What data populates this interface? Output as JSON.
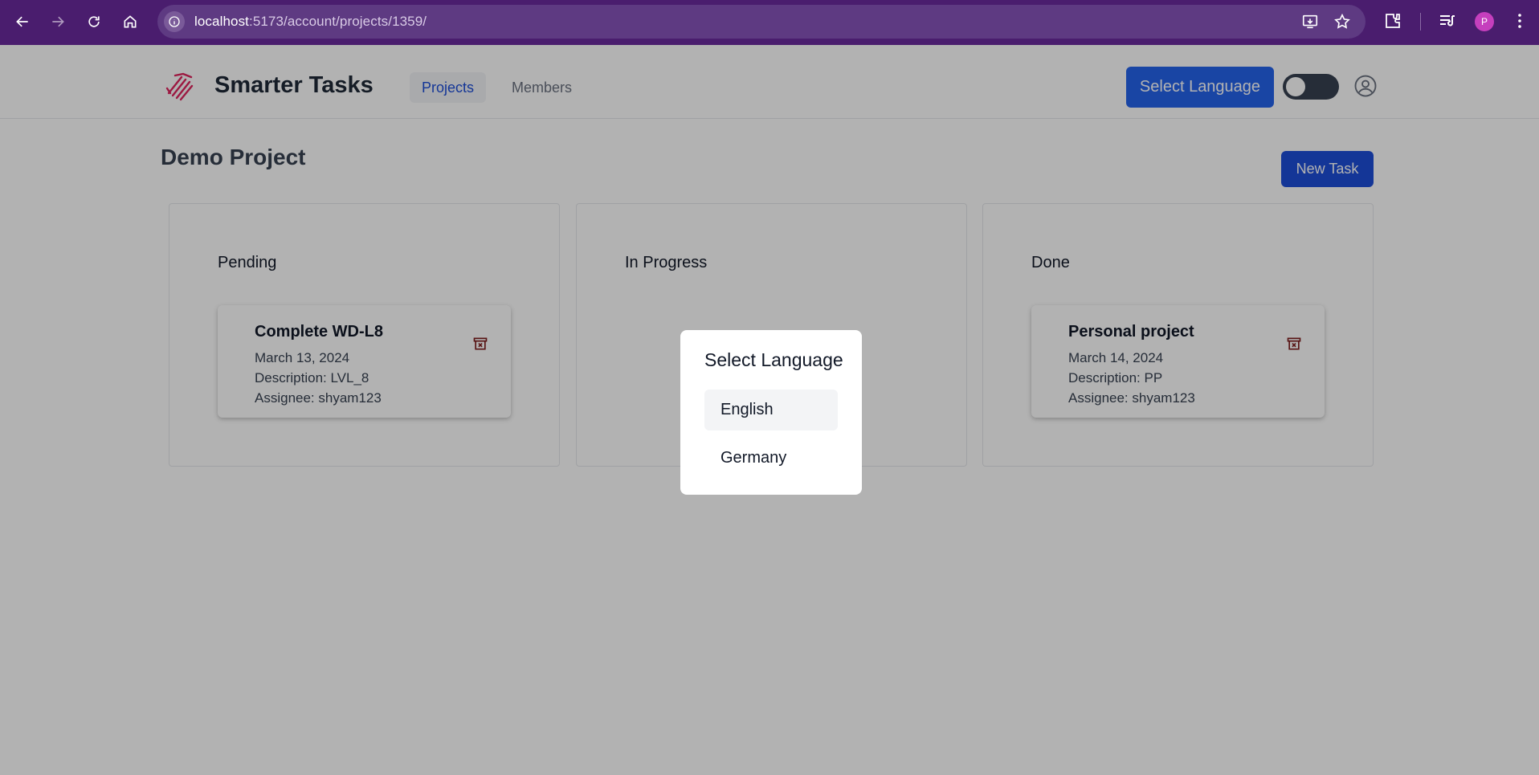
{
  "browser": {
    "url_host": "localhost",
    "url_path": ":5173/account/projects/1359/",
    "profile_initial": "P",
    "icons": [
      "back-icon",
      "forward-icon",
      "reload-icon",
      "home-icon",
      "site-info-icon",
      "install-app-icon",
      "bookmark-star-icon",
      "extensions-icon",
      "reading-list-icon",
      "menu-kebab-icon"
    ]
  },
  "header": {
    "brand": "Smarter Tasks",
    "nav": [
      {
        "label": "Projects",
        "active": true
      },
      {
        "label": "Members",
        "active": false
      }
    ],
    "language_button": "Select Language",
    "theme_toggle_on": false
  },
  "page": {
    "title": "Demo Project",
    "new_task_label": "New Task"
  },
  "columns": [
    {
      "title": "Pending",
      "cards": [
        {
          "title": "Complete WD-L8",
          "date": "March 13, 2024",
          "description": "Description: LVL_8",
          "assignee": "Assignee: shyam123"
        }
      ]
    },
    {
      "title": "In Progress",
      "cards": []
    },
    {
      "title": "Done",
      "cards": [
        {
          "title": "Personal project",
          "date": "March 14, 2024",
          "description": "Description: PP",
          "assignee": "Assignee: shyam123"
        }
      ]
    }
  ],
  "modal": {
    "title": "Select Language",
    "options": [
      "English",
      "Germany"
    ],
    "selected": "English"
  },
  "colors": {
    "browser_frame": "#4a1d6e",
    "primary": "#2563eb",
    "new_task": "#1d4ed8",
    "active_nav_text": "#1d4ed8",
    "trash_icon": "#7f1d1d",
    "overlay": "rgba(0,0,0,0.30)"
  }
}
